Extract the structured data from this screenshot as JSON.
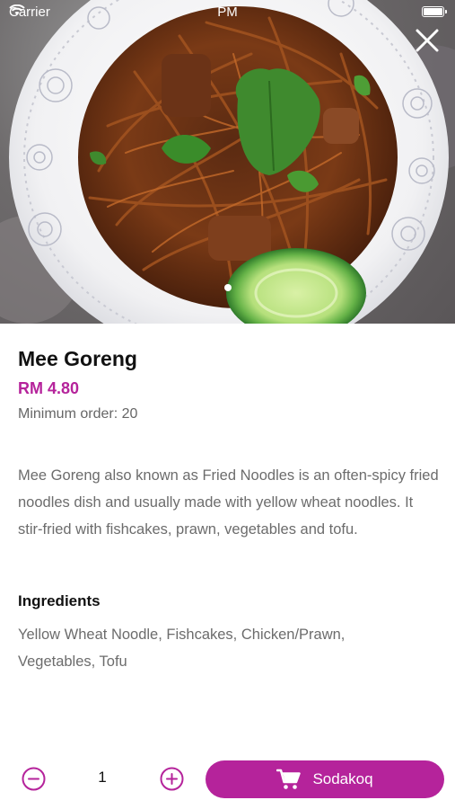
{
  "status_bar": {
    "carrier": "Carrier",
    "time": "PM"
  },
  "hero": {
    "image_alt": "Mee Goreng",
    "page_count": 1,
    "active_page": 1
  },
  "product": {
    "name": "Mee Goreng",
    "price": "RM 4.80",
    "minimum_order": "Minimum order: 20",
    "description": "Mee Goreng also known as Fried Noodles is an often-spicy fried noodles dish and usually made with yellow wheat noodles. It stir-fried with fishcakes, prawn, vegetables and tofu.",
    "ingredients_heading": "Ingredients",
    "ingredients": "Yellow Wheat Noodle, Fishcakes, Chicken/Prawn, Vegetables, Tofu"
  },
  "order": {
    "quantity": "1",
    "add_button_label": "Sodakoq"
  },
  "icons": {
    "close": "close-icon",
    "minus": "minus-circle-icon",
    "plus": "plus-circle-icon",
    "cart": "cart-icon",
    "wifi": "wifi-icon",
    "battery": "battery-icon"
  },
  "colors": {
    "accent": "#b5239b",
    "text_primary": "#111111",
    "text_secondary": "#6c6c6c"
  }
}
